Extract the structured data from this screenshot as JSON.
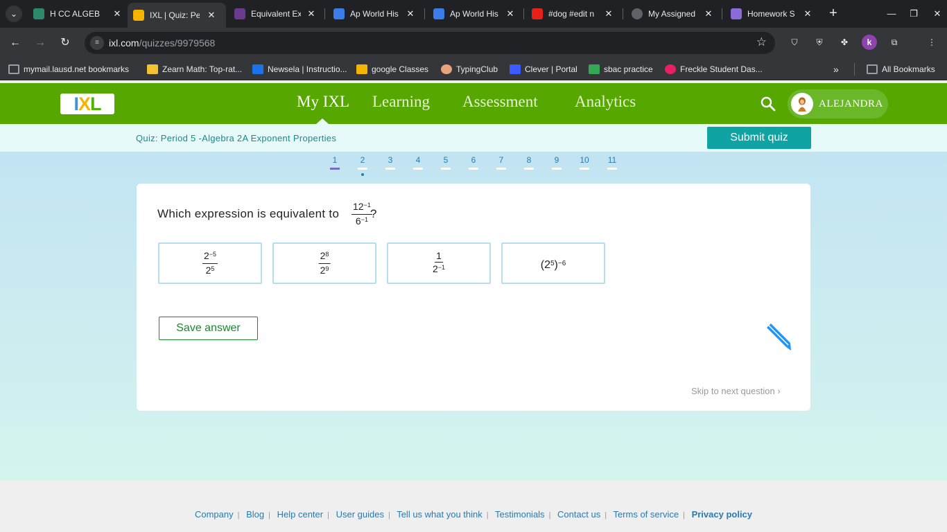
{
  "browser": {
    "tabs": [
      {
        "title": "H CC ALGEBR",
        "color": "#2c8a6a"
      },
      {
        "title": "IXL | Quiz: Pe",
        "color": "#f5b400",
        "active": true
      },
      {
        "title": "Equivalent Ex",
        "color": "#6a3b8c"
      },
      {
        "title": "Ap World His",
        "color": "#3b7de8"
      },
      {
        "title": "Ap World His",
        "color": "#3b7de8"
      },
      {
        "title": "#dog #edit n",
        "color": "#e62117"
      },
      {
        "title": "My Assigned",
        "color": "#5f6368"
      },
      {
        "title": "Homework S",
        "color": "#8a6bd8"
      }
    ],
    "url_domain": "ixl.com",
    "url_path": "/quizzes/9979568",
    "bookmarks": [
      {
        "label": "mymail.lausd.net bookmarks",
        "color": "#9aa0a6"
      },
      {
        "label": "Zearn Math: Top-rat...",
        "color": "#f1c232"
      },
      {
        "label": "Newsela | Instructio...",
        "color": "#1a73e8"
      },
      {
        "label": "google Classes",
        "color": "#f4b400"
      },
      {
        "label": "TypingClub",
        "color": "#e8a37c"
      },
      {
        "label": "Clever | Portal",
        "color": "#3d5afe"
      },
      {
        "label": "sbac practice",
        "color": "#34a853"
      },
      {
        "label": "Freckle Student Das...",
        "color": "#e91e63"
      }
    ],
    "all_bookmarks": "All Bookmarks"
  },
  "header": {
    "nav": [
      "My IXL",
      "Learning",
      "Assessment",
      "Analytics"
    ],
    "user": "ALEJANDRA"
  },
  "quiz": {
    "title": "Quiz: Period 5 -Algebra 2A Exponent Properties",
    "submit_label": "Submit quiz",
    "question_numbers": [
      "1",
      "2",
      "3",
      "4",
      "5",
      "6",
      "7",
      "8",
      "9",
      "10",
      "11"
    ],
    "current_question": 1,
    "question_prefix": "Which expression is equivalent to",
    "question_num_base": "12",
    "question_num_exp": "−1",
    "question_den_base": "6",
    "question_den_exp": "−1",
    "question_suffix": "?",
    "options": [
      {
        "num_base": "2",
        "num_exp": "−5",
        "den_base": "2",
        "den_exp": "5"
      },
      {
        "num_base": "2",
        "num_exp": "8",
        "den_base": "2",
        "den_exp": "9"
      },
      {
        "num_base": "1",
        "num_exp": "",
        "den_base": "2",
        "den_exp": "−1"
      },
      {
        "paren_text": "(2",
        "inner_exp": "5",
        "close": ")",
        "outer_exp": "−6"
      }
    ],
    "save_label": "Save answer",
    "skip_label": "Skip to next question"
  },
  "footer": {
    "links": [
      "Company",
      "Blog",
      "Help center",
      "User guides",
      "Tell us what you think",
      "Testimonials",
      "Contact us",
      "Terms of service",
      "Privacy policy"
    ]
  }
}
